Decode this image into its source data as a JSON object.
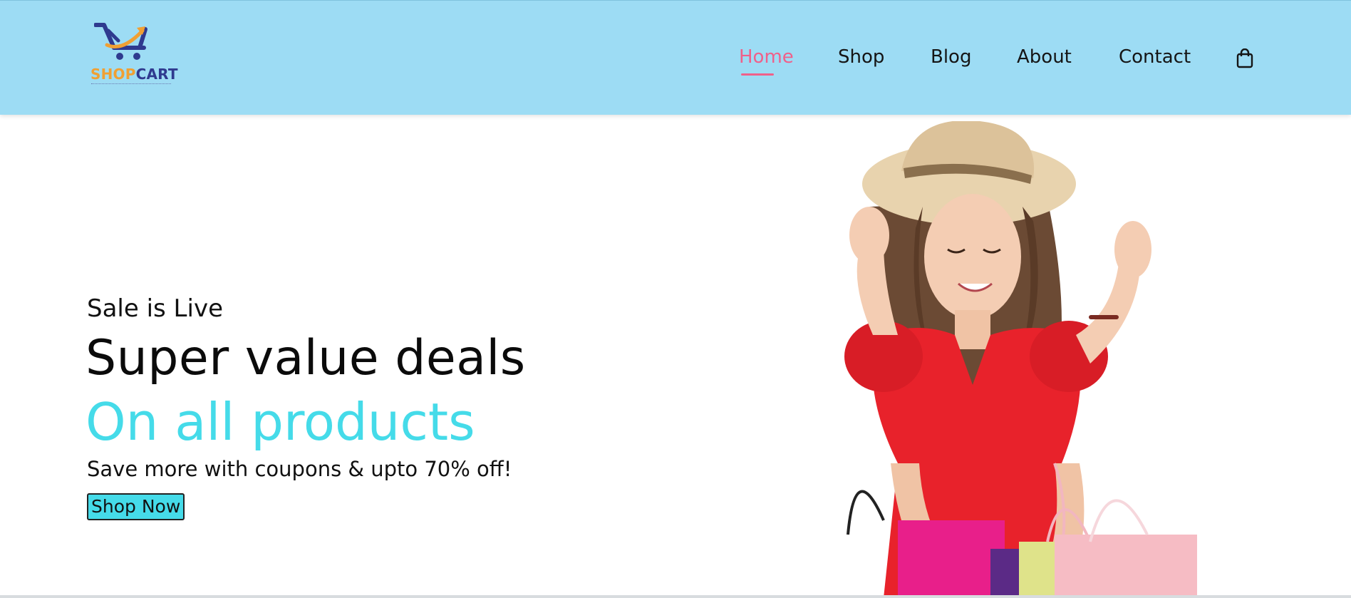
{
  "header": {
    "logo": {
      "word_1": "SHOP",
      "word_2": "CART",
      "colors": {
        "shop": "#f0a033",
        "cart": "#2f3a8f"
      }
    },
    "nav": [
      {
        "label": "Home",
        "active": true
      },
      {
        "label": "Shop",
        "active": false
      },
      {
        "label": "Blog",
        "active": false
      },
      {
        "label": "About",
        "active": false
      },
      {
        "label": "Contact",
        "active": false
      }
    ],
    "cart_icon": "shopping-bag-icon",
    "background": "#9ddcf4",
    "active_color": "#f0608a"
  },
  "hero": {
    "eyebrow": "Sale is Live",
    "headline": "Super value deals",
    "subheadline": "On all products",
    "tagline": "Save more with coupons & upto 70% off!",
    "cta_label": "Shop Now",
    "accent": "#45dbe9"
  }
}
